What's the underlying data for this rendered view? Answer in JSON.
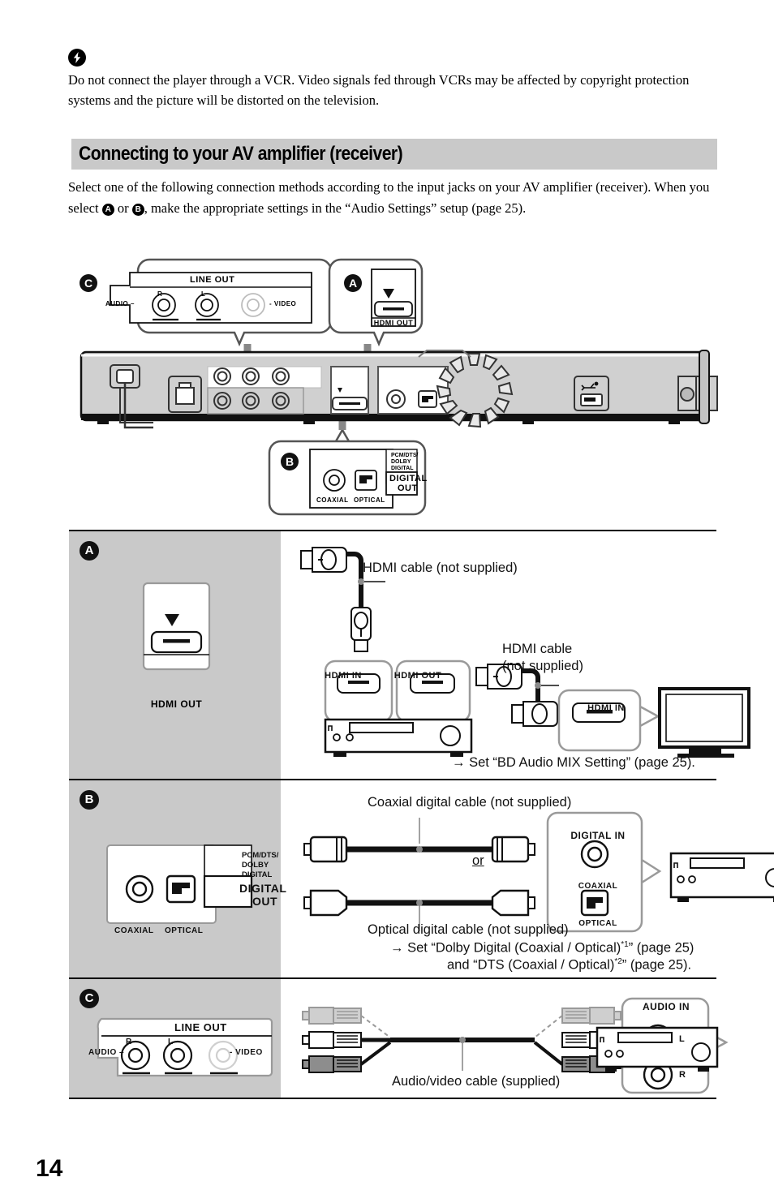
{
  "notice": {
    "icon": "warning-bolt-icon",
    "text": "Do not connect the player through a VCR. Video signals fed through VCRs may be affected by copyright protection systems and the picture will be distorted on the television."
  },
  "section": {
    "title": "Connecting to your AV amplifier (receiver)",
    "intro_part1": "Select one of the following connection methods according to the input jacks on your AV amplifier (receiver). When you select ",
    "badge_a": "A",
    "intro_or": " or ",
    "badge_b": "B",
    "intro_part2": ", make the appropriate settings in the “Audio Settings” setup (page 25)."
  },
  "diagram": {
    "callout_c": {
      "badge": "C",
      "title": "LINE OUT",
      "audio_label": "AUDIO –",
      "r_label": "R",
      "l_label": "L",
      "video_label": "- VIDEO"
    },
    "callout_a": {
      "badge": "A",
      "label": "HDMI OUT"
    },
    "callout_b": {
      "badge": "B",
      "format_label": "PCM/DTS/\nDOLBY\nDIGITAL",
      "format_line1": "PCM/DTS/",
      "format_line2": "DOLBY",
      "format_line3": "DIGITAL",
      "digital_out_line1": "DIGITAL",
      "digital_out_line2": "OUT",
      "coaxial_label": "COAXIAL",
      "optical_label": "OPTICAL"
    },
    "rear_panel": {
      "usb_icon": "usb-icon",
      "fan_icon": "fan-vent-icon",
      "lan_icon": "lan-port-icon"
    }
  },
  "table": {
    "rows": [
      {
        "badge": "A",
        "panel": {
          "label": "HDMI OUT"
        },
        "captions": {
          "cable1": "HDMI cable (not supplied)",
          "cable2_line1": "HDMI cable",
          "cable2_line2": "(not supplied)",
          "amp_hdmi_in": "HDMI IN",
          "amp_hdmi_out": "HDMI OUT",
          "tv_hdmi_in": "HDMI IN"
        },
        "setting": "→ Set “BD Audio MIX Setting” (page 25)."
      },
      {
        "badge": "B",
        "panel": {
          "format_line1": "PCM/DTS/",
          "format_line2": "DOLBY",
          "format_line3": "DIGITAL",
          "digital_out_line1": "DIGITAL",
          "digital_out_line2": "OUT",
          "coaxial_label": "COAXIAL",
          "optical_label": "OPTICAL"
        },
        "captions": {
          "coaxial_cable": "Coaxial digital cable (not supplied)",
          "or": "or",
          "optical_cable": "Optical digital cable (not supplied)",
          "digital_in": "DIGITAL IN",
          "in_coaxial": "COAXIAL",
          "in_optical": "OPTICAL"
        },
        "setting_line1_a": "→ Set “Dolby Digital (Coaxial / Optical)",
        "setting_line1_sup": "*1",
        "setting_line1_b": "” (page 25)",
        "setting_line2_a": "and “DTS (Coaxial / Optical)",
        "setting_line2_sup": "*2",
        "setting_line2_b": "” (page 25)."
      },
      {
        "badge": "C",
        "panel": {
          "title": "LINE OUT",
          "audio_label": "AUDIO –",
          "r_label": "R",
          "l_label": "L",
          "video_label": "- VIDEO"
        },
        "captions": {
          "cable": "Audio/video cable (supplied)",
          "audio_in": "AUDIO IN",
          "in_l": "L",
          "in_r": "R"
        }
      }
    ]
  },
  "footer": {
    "page_number": "14"
  },
  "colors": {
    "header_bar": "#c9c9c9",
    "gray_column": "#c9c9c9",
    "panel_body": "#bfbfbf",
    "ink": "#111111",
    "callout_stroke": "#555555"
  }
}
